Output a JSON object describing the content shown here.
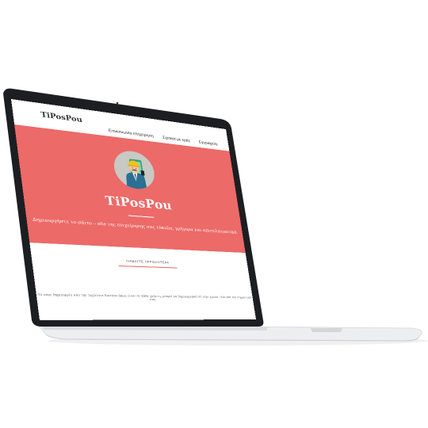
{
  "site": {
    "logo": "TiPosPou",
    "nav": {
      "items": [
        {
          "label": "Επικοινωνία επιχείρηση"
        },
        {
          "label": "Σχετικά με εμάς"
        },
        {
          "label": "Εγγραφείτε"
        }
      ]
    },
    "hero": {
      "title": "TiPosPou",
      "subtitle": "Δημιουργήστε το σάιτο – site της επιχείρησης σας εύκολα, γρήγορα και αποτελεσματικά."
    },
    "cta": {
      "label": "ΔΙΑΒΑΣΤΕ ΠΕΡΙΣΣΟΤΕΡΑ"
    },
    "footnote": "Το πάνε δημιουργία από την ταχύτητα δικτύου όπως είναι σε κάθε χρήστη, μπορεί να δημιουργηθεί σε λίγο χρόνο · όλα και πιο σημαντικά σας."
  },
  "colors": {
    "brand": "#ec6a68",
    "laptop_bezel": "#1d1e22",
    "laptop_body": "#eeeff1"
  }
}
